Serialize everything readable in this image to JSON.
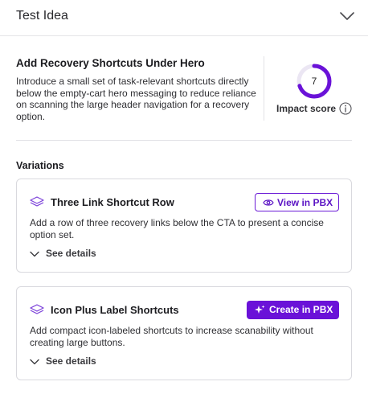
{
  "header": {
    "title": "Test Idea"
  },
  "idea": {
    "title": "Add Recovery Shortcuts Under Hero",
    "description": "Introduce a small set of task-relevant shortcuts directly below the empty-cart hero messaging to reduce reliance on scanning the large header navigation for a recovery option.",
    "impact_score": "7",
    "impact_fraction": 0.7,
    "impact_label": "Impact score"
  },
  "variations": {
    "heading": "Variations",
    "items": [
      {
        "title": "Three Link Shortcut Row",
        "description": "Add a row of three recovery links below the CTA to present a concise option set.",
        "action_label": "View in PBX",
        "action_icon": "eye-icon",
        "details_label": "See details"
      },
      {
        "title": "Icon Plus Label Shortcuts",
        "description": "Add compact icon-labeled shortcuts to increase scanability without creating large buttons.",
        "action_label": "Create in PBX",
        "action_icon": "sparkle-icon",
        "details_label": "See details"
      }
    ]
  },
  "colors": {
    "accent": "#6a12d8",
    "ring_track": "#ebe6f3",
    "border": "#d9d9de"
  }
}
